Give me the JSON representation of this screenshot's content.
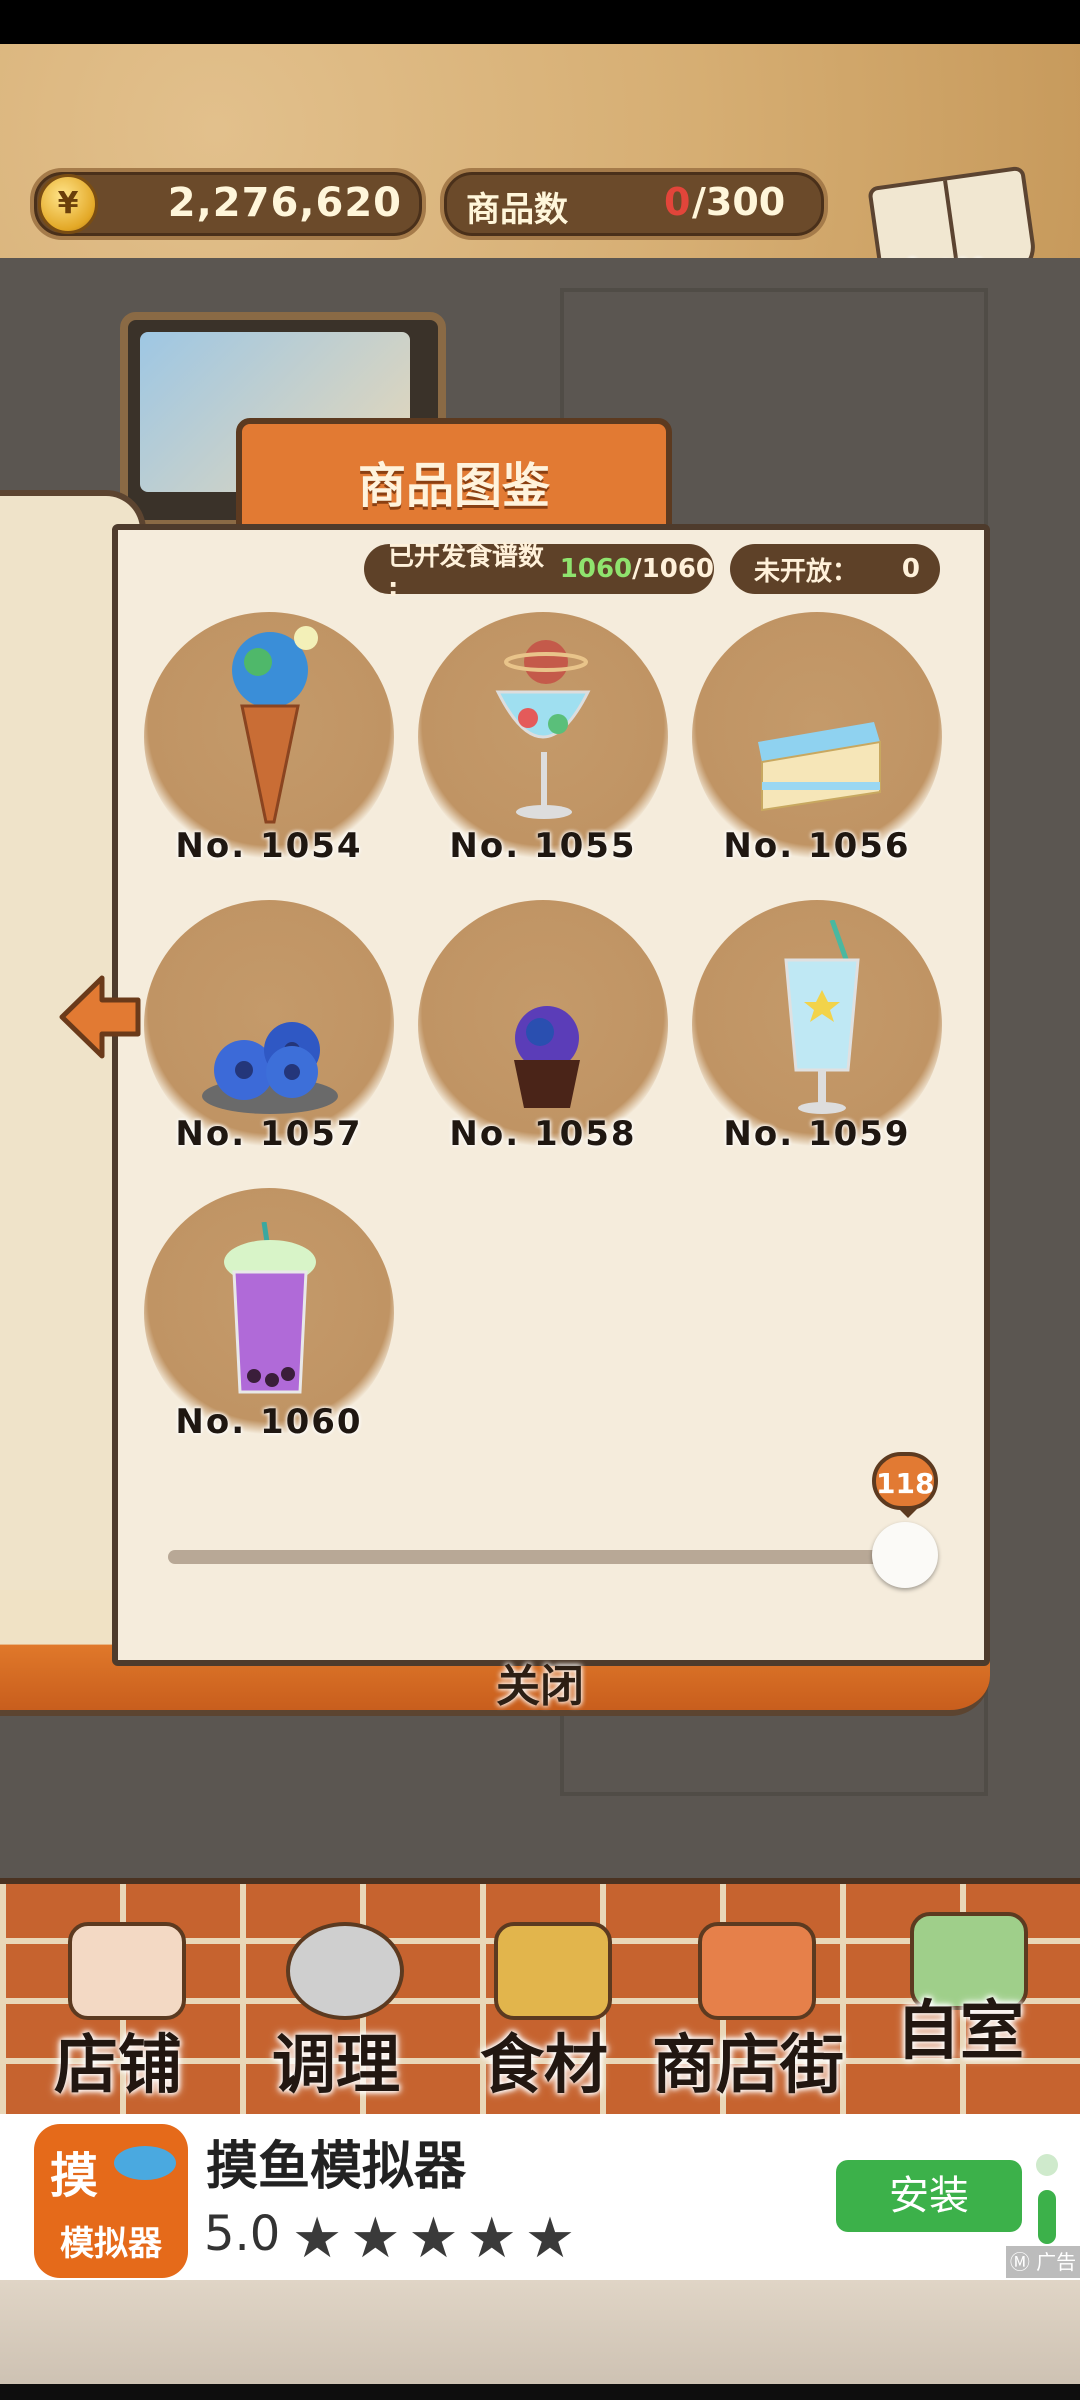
{
  "currency": {
    "icon": "¥",
    "value": "2,276,620"
  },
  "product_count": {
    "label": "商品数",
    "current": "0",
    "separator": "/",
    "max": "300"
  },
  "recipe_button": {
    "label": "食谱"
  },
  "catalog": {
    "title": "商品图鉴",
    "developed_label": "已开发食谱数 :",
    "developed_value": "1060",
    "developed_total": "/1060",
    "unopened_label": "未开放：",
    "unopened_value": "0",
    "items": [
      {
        "label": "No. 1054",
        "icon": "ice-cream-cone-icon"
      },
      {
        "label": "No. 1055",
        "icon": "parfait-glass-icon"
      },
      {
        "label": "No. 1056",
        "icon": "cake-slice-icon"
      },
      {
        "label": "No. 1057",
        "icon": "donuts-icon"
      },
      {
        "label": "No. 1058",
        "icon": "cupcake-icon"
      },
      {
        "label": "No. 1059",
        "icon": "soda-glass-icon"
      },
      {
        "label": "No. 1060",
        "icon": "bubble-tea-icon"
      }
    ],
    "slider_value": "118",
    "close_label": "关闭"
  },
  "nav": [
    {
      "label": "店铺",
      "icon": "shop-cake-icon"
    },
    {
      "label": "调理",
      "icon": "mixing-bowl-icon"
    },
    {
      "label": "食材",
      "icon": "ingredient-sack-icon"
    },
    {
      "label": "商店街",
      "icon": "shopping-street-icon"
    },
    {
      "label": "自室",
      "icon": "staff-only-sign-icon"
    }
  ],
  "ad": {
    "logo_top": "摸",
    "logo_bottom": "模拟器",
    "title": "摸鱼模拟器",
    "rating": "5.0",
    "stars": "★★★★★",
    "install_label": "安装",
    "tag": "Ⓜ 广告"
  },
  "colors": {
    "accent_orange": "#e27a33",
    "developed_green": "#8fe36e",
    "current_red": "#e2453a",
    "install_green": "#3cb14a"
  }
}
